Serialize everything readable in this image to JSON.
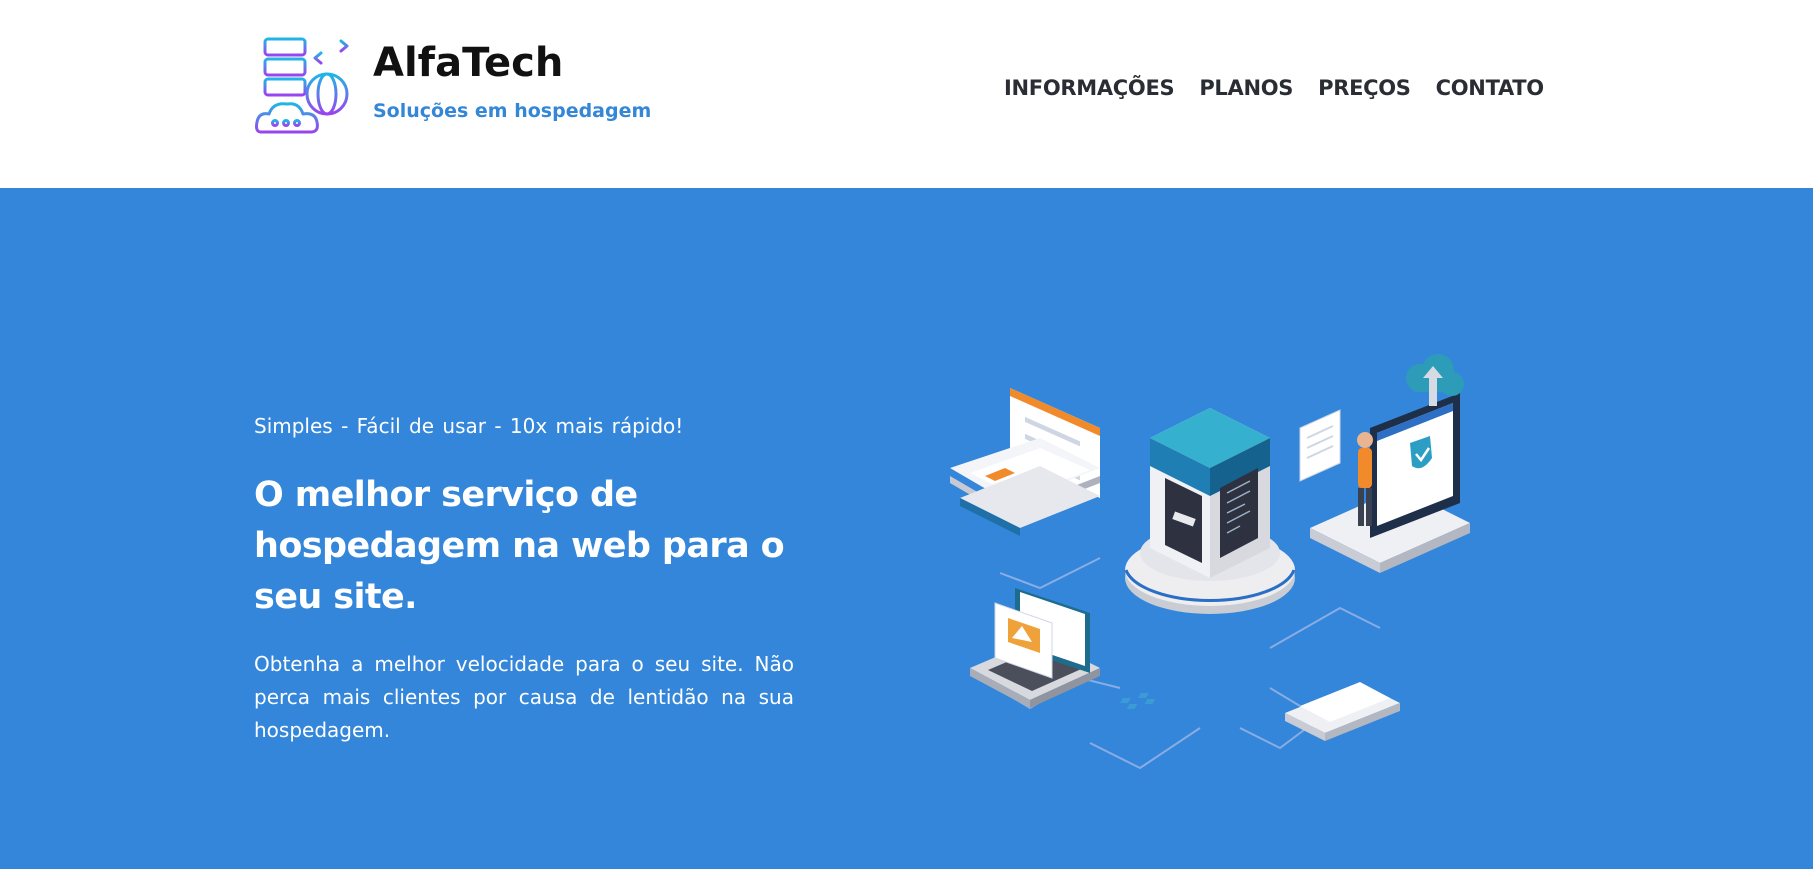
{
  "brand": {
    "name": "AlfaTech",
    "tagline": "Soluções em hospedagem",
    "logo_icon": "server-cloud-globe-icon"
  },
  "nav": {
    "items": [
      {
        "label": "INFORMAÇÕES"
      },
      {
        "label": "PLANOS"
      },
      {
        "label": "PREÇOS"
      },
      {
        "label": "CONTATO"
      }
    ]
  },
  "hero": {
    "tagline": "Simples - Fácil de usar - 10x mais rápido!",
    "headline": "O melhor serviço de hospedagem na web para o seu site.",
    "description": "Obtenha a melhor velocidade para o seu site. Não perca mais clientes por causa de lentidão na sua hospedagem.",
    "illustration": "isometric-hosting-illustration"
  },
  "colors": {
    "hero_background": "#3386d9",
    "accent_blue": "#3486d6",
    "nav_text": "#2a2d33"
  }
}
